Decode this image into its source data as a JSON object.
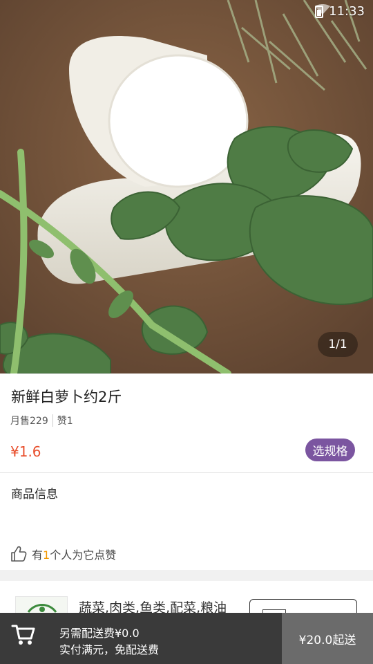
{
  "status_bar": {
    "time": "11:33"
  },
  "gallery": {
    "pager": "1/1"
  },
  "product": {
    "title": "新鲜白萝卜约2斤",
    "monthly_sales": "月售229",
    "likes_label": "赞1",
    "price": "¥1.6",
    "spec_button": "选规格"
  },
  "info": {
    "section_title": "商品信息",
    "likes_prefix": "有",
    "likes_count": "1",
    "likes_suffix": "个人为它点赞"
  },
  "shop": {
    "description": "蔬菜,肉类,鱼类,配菜,粮油"
  },
  "bottom_bar": {
    "delivery_fee": "另需配送费¥0.0",
    "free_delivery": "实付满元，免配送费",
    "min_order_button": "¥20.0起送"
  },
  "colors": {
    "price": "#e8502e",
    "spec_button": "#7b55a0",
    "likes_count": "#f39800",
    "bottom_bar": "#3a3a3a",
    "min_order_button": "#6b6b6b"
  }
}
